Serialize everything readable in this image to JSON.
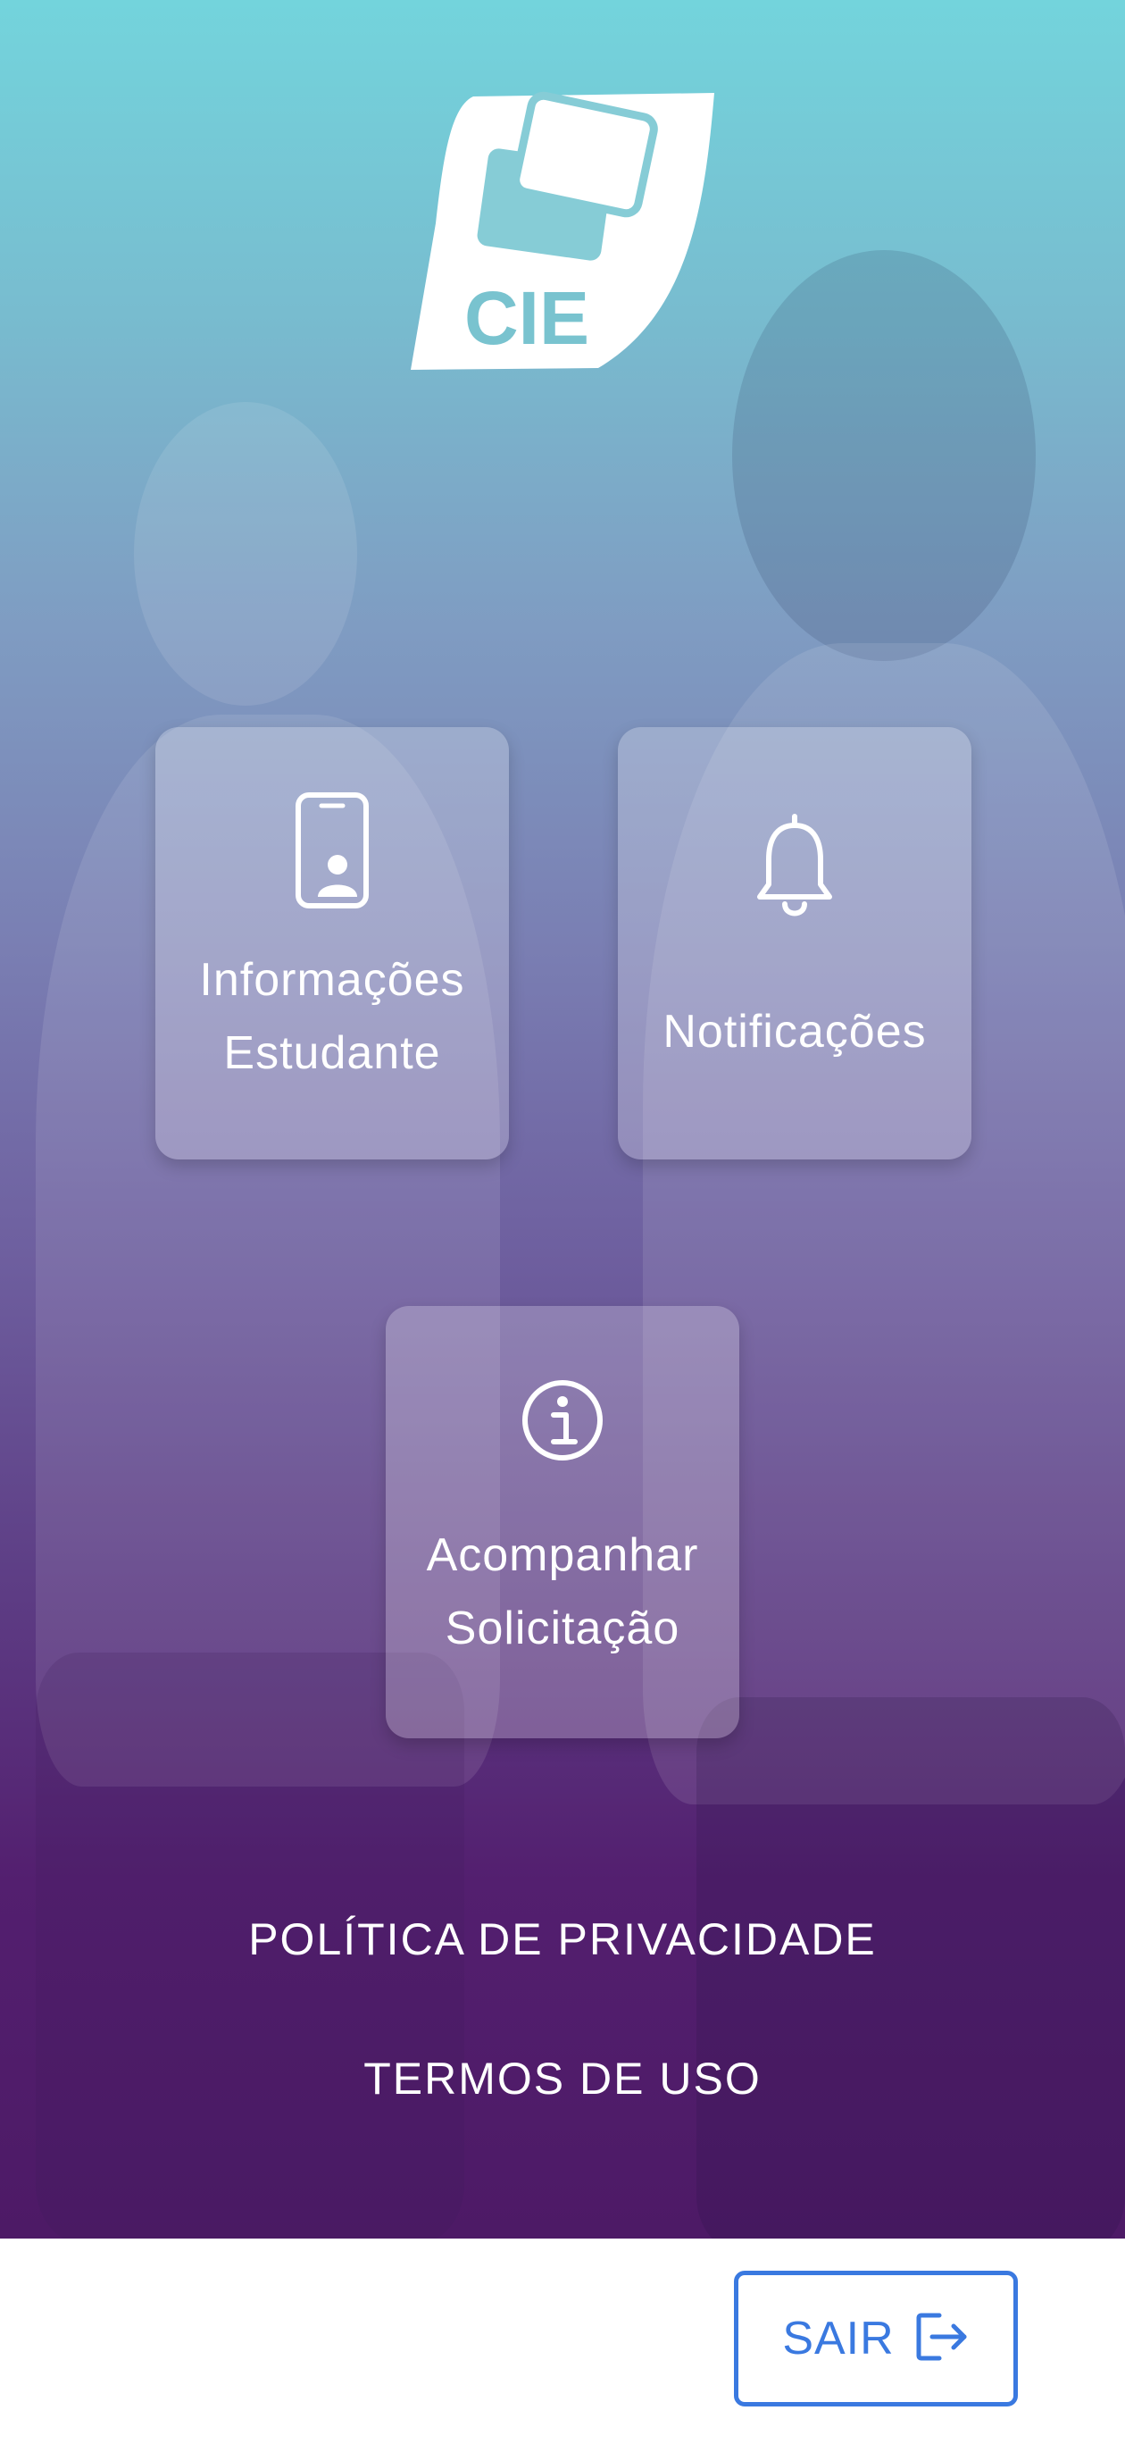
{
  "app": {
    "logo_text": "CIE"
  },
  "menu": {
    "informacoes": {
      "label": "Informações\nEstudante",
      "icon": "phone-user-icon"
    },
    "notificacoes": {
      "label": "Notificações",
      "icon": "bell-icon"
    },
    "acompanhar": {
      "label": "Acompanhar\nSolicitação",
      "icon": "info-icon"
    }
  },
  "links": {
    "privacidade": "POLÍTICA DE PRIVACIDADE",
    "termos": "TERMOS DE USO"
  },
  "footer": {
    "sair_label": "SAIR",
    "sair_icon": "logout-icon",
    "accent": "#3a79e0"
  }
}
